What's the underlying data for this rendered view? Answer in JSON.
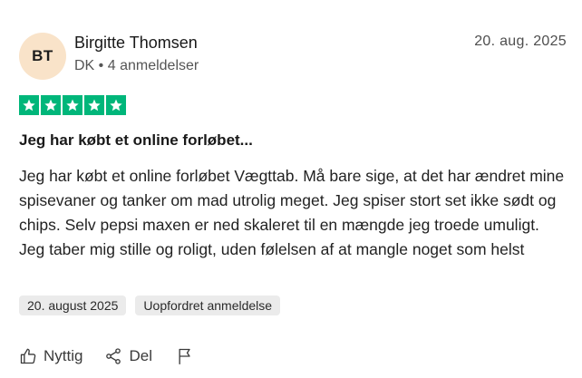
{
  "review": {
    "reviewer": {
      "initials": "BT",
      "name": "Birgitte Thomsen",
      "meta": "DK • 4 anmeldelser"
    },
    "date": "20. aug. 2025",
    "rating": {
      "stars": 5,
      "max": 5,
      "color": "#00b67a"
    },
    "title": "Jeg har købt et online forløbet...",
    "body": "Jeg har købt et online forløbet Vægttab. Må bare sige, at det har ændret mine spisevaner og tanker om mad utrolig meget. Jeg spiser stort set ikke sødt og chips. Selv pepsi maxen er ned skaleret til en mængde jeg troede umuligt. Jeg taber mig stille og roligt, uden følelsen af at mangle noget som helst",
    "tags": [
      "20. august 2025",
      "Uopfordret anmeldelse"
    ],
    "actions": {
      "useful": {
        "label": "Nyttig",
        "icon": "thumbs-up-icon"
      },
      "share": {
        "label": "Del",
        "icon": "share-icon"
      },
      "report": {
        "icon": "flag-icon"
      }
    }
  }
}
